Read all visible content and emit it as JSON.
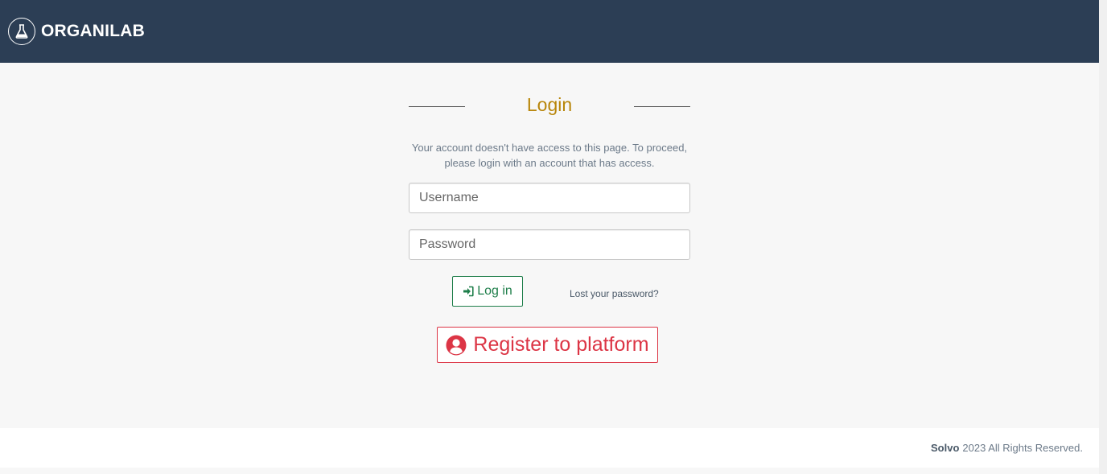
{
  "navbar": {
    "brand": "ORGANILAB",
    "logo_icon": "flask-icon",
    "background": "#2c3e55"
  },
  "login": {
    "title": "Login",
    "notice": "Your account doesn't have access to this page. To proceed, please login with an account that has access.",
    "username_placeholder": "Username",
    "password_placeholder": "Password",
    "login_button": "Log in",
    "login_icon": "sign-in-icon",
    "lost_password": "Lost your password?",
    "register_button": "Register to platform",
    "register_icon": "user-circle-icon"
  },
  "footer": {
    "company": "Solvo",
    "text": "2023 All Rights Reserved."
  },
  "colors": {
    "title": "#b8860b",
    "login_button": "#1e7e4a",
    "register_button": "#dc3545"
  }
}
